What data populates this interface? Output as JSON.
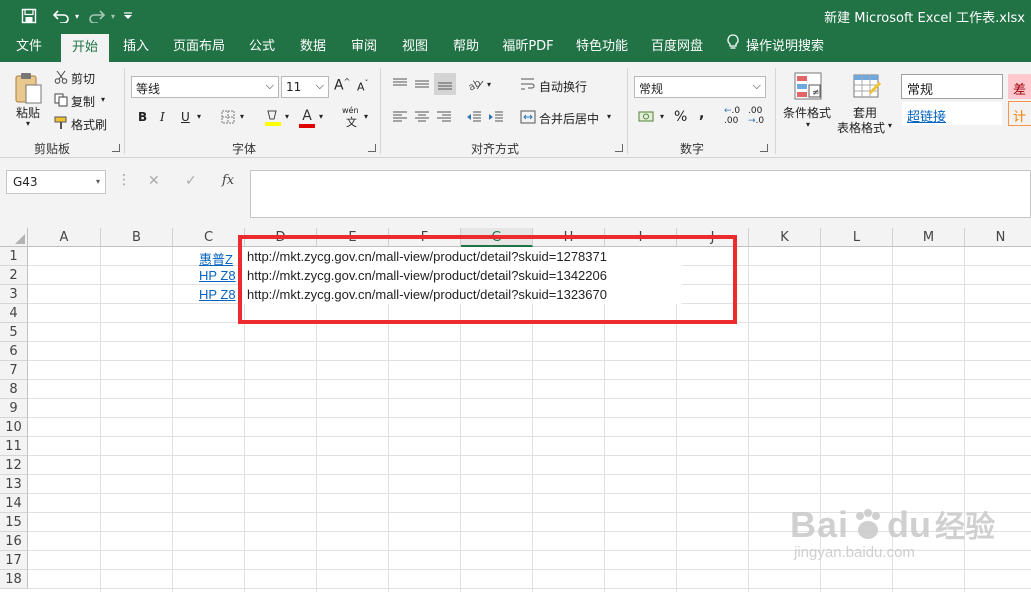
{
  "titlebar": {
    "title": "新建 Microsoft Excel 工作表.xlsx",
    "icons": [
      "save-icon",
      "undo-icon",
      "redo-icon",
      "customize-qat-icon"
    ]
  },
  "tabs": [
    "文件",
    "开始",
    "插入",
    "页面布局",
    "公式",
    "数据",
    "审阅",
    "视图",
    "帮助",
    "福昕PDF",
    "特色功能",
    "百度网盘"
  ],
  "active_tab": "开始",
  "tell_me": "操作说明搜索",
  "ribbon": {
    "clipboard": {
      "paste": "粘贴",
      "cut": "剪切",
      "copy": "复制",
      "format_painter": "格式刷",
      "label": "剪贴板"
    },
    "font": {
      "font_name": "等线",
      "font_size": "11",
      "grow": "A",
      "shrink": "A",
      "bold": "B",
      "italic": "I",
      "underline": "U",
      "font_color": "A",
      "phonetic_top": "wén",
      "phonetic_bottom": "文",
      "label": "字体"
    },
    "alignment": {
      "wrap": "自动换行",
      "merge": "合并后居中",
      "label": "对齐方式"
    },
    "number": {
      "format": "常规",
      "percent": "%",
      "comma": ",",
      "inc_decimal": ".00",
      "dec_decimal": ".0",
      "label": "数字"
    },
    "styles": {
      "conditional": "条件格式",
      "table_1": "套用",
      "table_2": "表格格式",
      "normal": "常规",
      "hyperlink": "超链接",
      "bad": "差",
      "calc": "计"
    }
  },
  "formula_bar": {
    "name_box": "G43",
    "cancel": "✕",
    "enter": "✓",
    "fx": "fx",
    "formula": ""
  },
  "grid": {
    "columns": [
      "A",
      "B",
      "C",
      "D",
      "E",
      "F",
      "G",
      "H",
      "I",
      "J",
      "K",
      "L",
      "M",
      "N"
    ],
    "selected_column": "G",
    "rows": [
      "1",
      "2",
      "3",
      "4",
      "5",
      "6",
      "7",
      "8",
      "9",
      "10",
      "11",
      "12",
      "13",
      "14",
      "15",
      "16",
      "17",
      "18"
    ],
    "cells": {
      "C1": "惠普Z",
      "C2": "HP Z8",
      "C3": "HP Z8",
      "D1": "http://mkt.zycg.gov.cn/mall-view/product/detail?skuid=1278371",
      "D2": "http://mkt.zycg.gov.cn/mall-view/product/detail?skuid=1342206",
      "D3": "http://mkt.zycg.gov.cn/mall-view/product/detail?skuid=1323670"
    }
  },
  "watermark": {
    "brand": "Bai",
    "brand2": "du",
    "cn": "经验",
    "url": "jingyan.baidu.com"
  },
  "colors": {
    "excel_green": "#217346",
    "highlight_red": "#ec2b2f",
    "link_blue": "#0563c1"
  }
}
